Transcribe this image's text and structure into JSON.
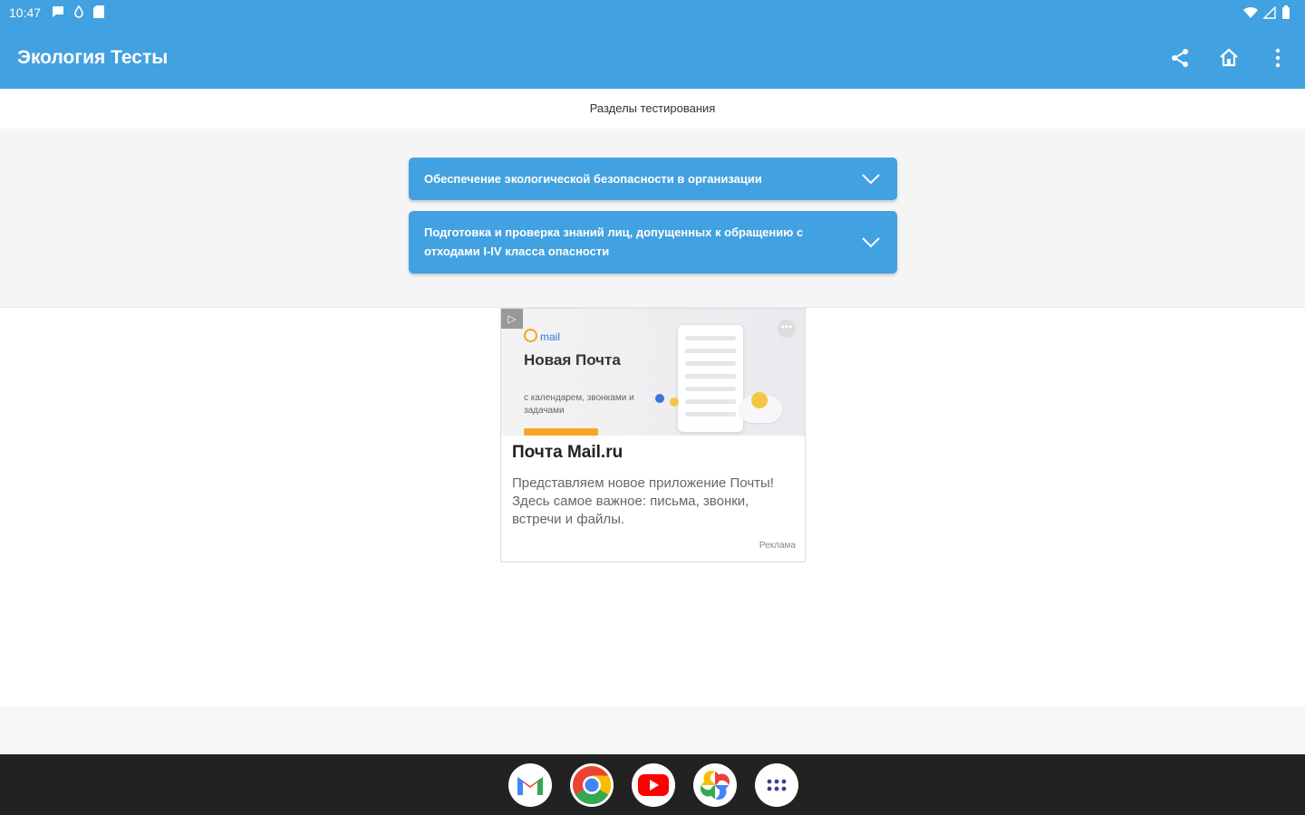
{
  "status_bar": {
    "time": "10:47"
  },
  "app_bar": {
    "title": "Экология Тесты"
  },
  "subheader": {
    "text": "Разделы тестирования"
  },
  "sections": [
    {
      "label": "Обеспечение экологической безопасности в организации"
    },
    {
      "label": "Подготовка и проверка знаний лиц, допущенных к обращению с отходами I-IV класса опасности"
    }
  ],
  "ad": {
    "tag": "▷",
    "brand": "mail",
    "banner_headline": "Новая Почта",
    "banner_sub": "с календарем, звонками и задачами",
    "headline": "Почта Mail.ru",
    "description": "Представляем новое приложение Почты! Здесь самое важное: письма, звонки, встречи и файлы.",
    "label": "Реклама"
  },
  "dock": {
    "apps": [
      "gmail",
      "chrome",
      "youtube",
      "photos",
      "app-drawer"
    ]
  },
  "colors": {
    "primary": "#42a1e0",
    "navbar": "#222222"
  }
}
